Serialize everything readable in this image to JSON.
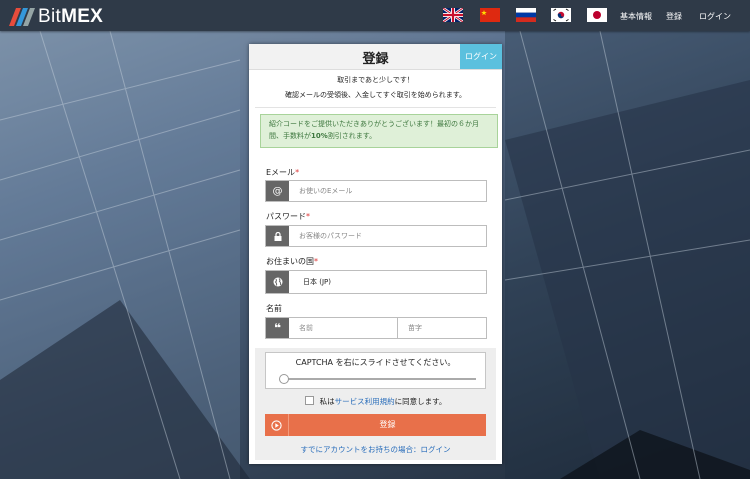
{
  "header": {
    "brand_bit": "Bit",
    "brand_mex": "MEX",
    "nav": [
      "基本情報",
      "登録",
      "ログイン"
    ],
    "flags": [
      "uk-flag",
      "china-flag",
      "russia-flag",
      "korea-flag",
      "japan-flag"
    ]
  },
  "card": {
    "title": "登録",
    "login_tab": "ログイン",
    "intro_line1": "取引まであと少しです！",
    "intro_line2": "確認メールの受領後、入金してすぐ取引を始められます。",
    "referral_notice": "紹介コードをご提供いただきありがとうございます！最初の６か月間、手数料が",
    "referral_discount": "10%",
    "referral_suffix": "割引されます。"
  },
  "form": {
    "email_label": "Eメール",
    "email_placeholder": "お使いのEメール",
    "password_label": "パスワード",
    "password_placeholder": "お客様のパスワード",
    "country_label": "お住まいの国",
    "country_value": "日本 (JP)",
    "name_label": "名前",
    "first_name_placeholder": "名前",
    "last_name_placeholder": "苗字",
    "required_mark": "*"
  },
  "captcha": {
    "text": "CAPTCHA を右にスライドさせてください。",
    "slider_value": 0
  },
  "agreement": {
    "prefix": "私は",
    "link": "サービス利用規約",
    "suffix": "に同意します。"
  },
  "submit_label": "登録",
  "have_account": "すでにアカウントをお持ちの場合：ログイン",
  "colors": {
    "topbar": "#2f3a48",
    "accent": "#5bc0de",
    "submit": "#e8704a",
    "link": "#2a6ebb",
    "alert_bg": "#dff0d8"
  }
}
